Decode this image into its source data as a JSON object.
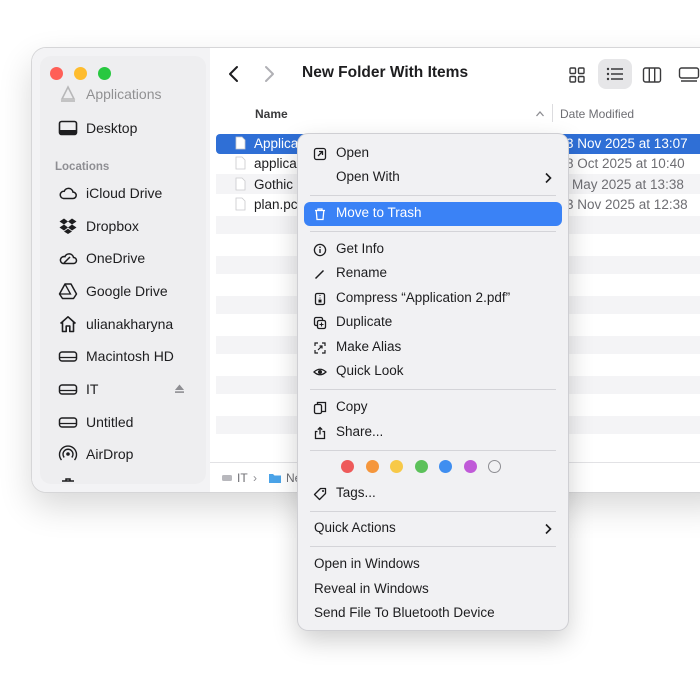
{
  "window": {
    "title": "New Folder With Items",
    "traffic_lights": {
      "close": "#ff5f57",
      "minimize": "#febc2e",
      "zoom": "#28c840"
    }
  },
  "sidebar": {
    "applications": "Applications",
    "desktop": "Desktop",
    "locations_header": "Locations",
    "items": [
      {
        "label": "iCloud Drive",
        "icon": "cloud-icon"
      },
      {
        "label": "Dropbox",
        "icon": "dropbox-icon"
      },
      {
        "label": "OneDrive",
        "icon": "onedrive-icon"
      },
      {
        "label": "Google Drive",
        "icon": "google-drive-icon"
      },
      {
        "label": "ulianakharyna",
        "icon": "home-icon"
      },
      {
        "label": "Macintosh HD",
        "icon": "drive-icon"
      },
      {
        "label": "IT",
        "icon": "drive-icon"
      },
      {
        "label": "Untitled",
        "icon": "drive-icon"
      },
      {
        "label": "AirDrop",
        "icon": "airdrop-icon"
      }
    ]
  },
  "columns": {
    "name": "Name",
    "date": "Date Modified"
  },
  "files": [
    {
      "name": "Applica",
      "date": "3 Nov 2025 at 13:07",
      "selected": true
    },
    {
      "name": "applica",
      "date": "8 Oct 2025 at 10:40"
    },
    {
      "name": "Gothic",
      "date": "May 2025 at 13:38"
    },
    {
      "name": "plan.pc",
      "date": "3 Nov 2025 at 12:38"
    }
  ],
  "pathbar": {
    "part1": "IT",
    "part2": "Ne"
  },
  "menu": {
    "open": "Open",
    "open_with": "Open With",
    "move_to_trash": "Move to Trash",
    "get_info": "Get Info",
    "rename": "Rename",
    "compress": "Compress “Application 2.pdf”",
    "duplicate": "Duplicate",
    "make_alias": "Make Alias",
    "quick_look": "Quick Look",
    "copy": "Copy",
    "share": "Share...",
    "tags": "Tags...",
    "quick_actions": "Quick Actions",
    "open_in_windows": "Open in Windows",
    "reveal_in_windows": "Reveal in Windows",
    "send_bluetooth": "Send File To Bluetooth Device",
    "tag_colors": [
      "#ee5a5a",
      "#f5963c",
      "#f7c948",
      "#5cc15a",
      "#3f8ef0",
      "#c05ad8"
    ]
  },
  "colors": {
    "accent": "#3a82f6",
    "selection": "#2f6fd6"
  }
}
